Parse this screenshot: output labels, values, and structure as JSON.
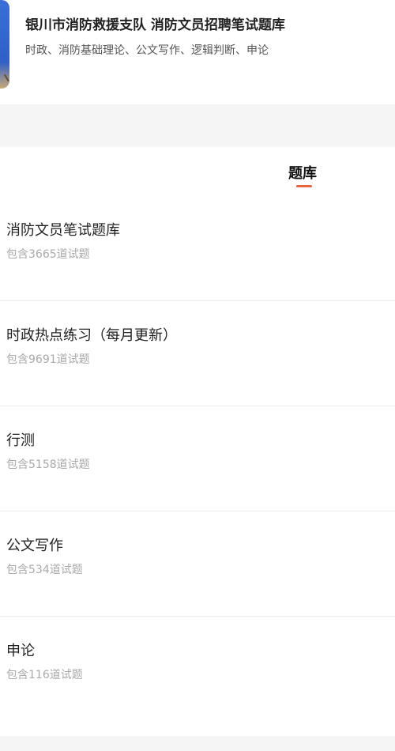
{
  "header": {
    "title": "银川市消防救援支队 消防文员招聘笔试题库",
    "subtitle": "时政、消防基础理论、公文写作、逻辑判断、申论"
  },
  "tabs": [
    {
      "label": "题库",
      "active": true
    }
  ],
  "accent_color": "#e8643a",
  "question_banks": [
    {
      "name": "消防文员笔试题库",
      "count": "包含3665道试题"
    },
    {
      "name": "时政热点练习（每月更新）",
      "count": "包含9691道试题"
    },
    {
      "name": "行测",
      "count": "包含5158道试题"
    },
    {
      "name": "公文写作",
      "count": "包含534道试题"
    },
    {
      "name": "申论",
      "count": "包含116道试题"
    }
  ]
}
